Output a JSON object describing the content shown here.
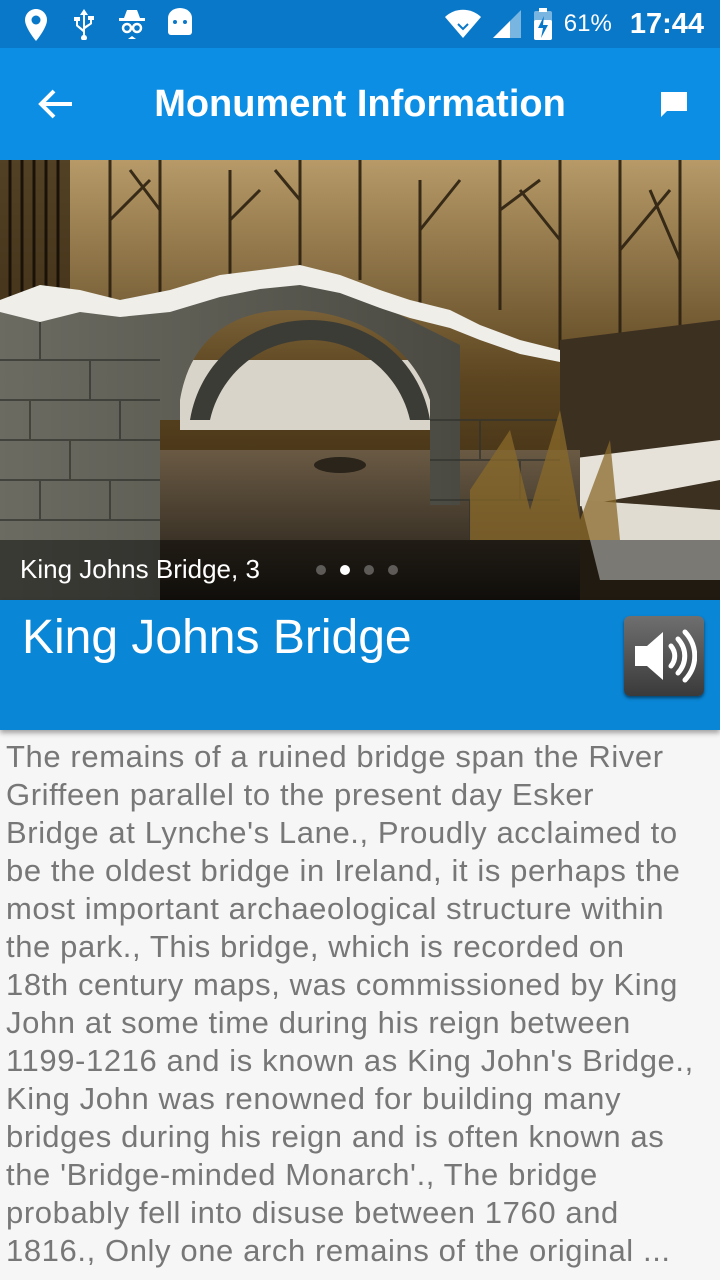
{
  "status_bar": {
    "battery_percent": "61%",
    "time": "17:44",
    "icons": [
      "location-icon",
      "usb-icon",
      "incognito-icon",
      "android-icon",
      "wifi-icon",
      "signal-icon",
      "battery-charging-icon"
    ]
  },
  "app_bar": {
    "title": "Monument Information",
    "back_icon": "arrow-left-icon",
    "action_icon": "chat-icon",
    "color": "#0c8ee4"
  },
  "gallery": {
    "caption": "King Johns Bridge, 3",
    "page_count": 4,
    "active_page": 2
  },
  "monument": {
    "name": "King Johns Bridge",
    "audio_icon": "speaker-icon",
    "description": "The remains of a ruined bridge span the River Griffeen parallel to the present day Esker Bridge at Lynche's Lane.,  Proudly acclaimed to be the oldest bridge in Ireland, it is perhaps the most important archaeological structure within the park.,  This bridge, which is recorded on 18th century maps, was commissioned by King John at some time during his reign between 1199-1216 and is known as King John's Bridge., King John was renowned for building many bridges during his reign and is often known as the 'Bridge-minded Monarch'., The bridge probably fell into disuse between 1760 and 1816., Only one arch remains of the original ..."
  },
  "colors": {
    "status_bar": "#0a78c8",
    "title_panel": "#0a86d6"
  }
}
